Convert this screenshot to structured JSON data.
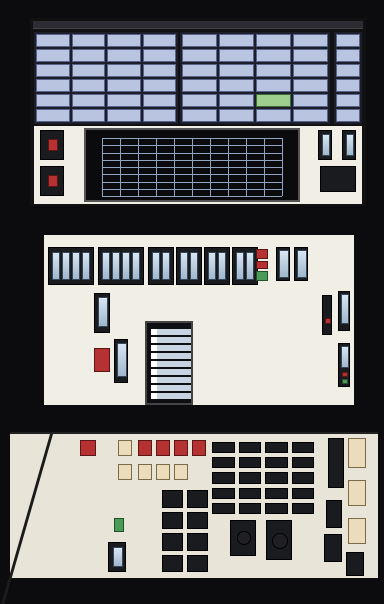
{
  "scene": {
    "description": "",
    "panels": [
      "top-display",
      "middle-display",
      "bottom-console"
    ]
  },
  "colors": {
    "background": "#0c0c0e",
    "screen": "#f1eee6",
    "button_blue": "#b9c5e0",
    "button_green": "#9ecf8e",
    "alarm_red": "#b63232",
    "status_green": "#4b9b58",
    "console_cream": "#ecdcbc"
  },
  "icons": [
    "gauge-icon",
    "switch-icon",
    "knob-icon",
    "indicator-lamp-icon"
  ]
}
